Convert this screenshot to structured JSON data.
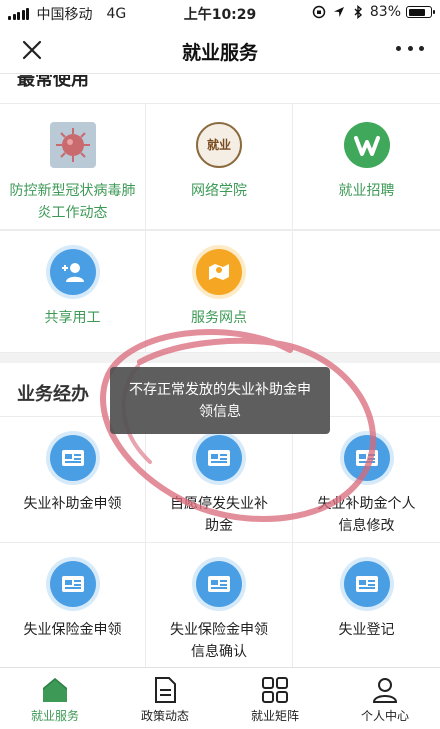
{
  "status_bar": {
    "carrier": "中国移动",
    "network": "4G",
    "time": "上午10:29",
    "battery": "83%",
    "battery_level": 0.83
  },
  "nav": {
    "title": "就业服务",
    "close_icon": "close-icon",
    "more_icon": "more-icon"
  },
  "section_frequent": {
    "title": "最常使用",
    "items": [
      {
        "label": "防控新型冠状病毒肺炎工作动态",
        "icon": "virus-image-icon"
      },
      {
        "label": "网络学院",
        "icon": "seal-logo-icon",
        "seal_text": "就业"
      },
      {
        "label": "就业招聘",
        "icon": "job-logo-icon"
      },
      {
        "label": "共享用工",
        "icon": "add-user-icon"
      },
      {
        "label": "服务网点",
        "icon": "map-pin-icon"
      }
    ]
  },
  "section_business": {
    "title": "业务经办",
    "items": [
      {
        "label": "失业补助金申领",
        "icon": "document-icon"
      },
      {
        "label": "自愿停发失业补助金",
        "icon": "document-icon"
      },
      {
        "label": "失业补助金个人信息修改",
        "icon": "document-icon"
      },
      {
        "label": "失业保险金申领",
        "icon": "document-icon"
      },
      {
        "label": "失业保险金申领信息确认",
        "icon": "document-icon"
      },
      {
        "label": "失业登记",
        "icon": "document-icon"
      }
    ]
  },
  "toast": {
    "message": "不存正常发放的失业补助金申领信息"
  },
  "tabbar": {
    "items": [
      {
        "label": "就业服务",
        "icon": "home-icon",
        "active": true
      },
      {
        "label": "政策动态",
        "icon": "policy-document-icon",
        "active": false
      },
      {
        "label": "就业矩阵",
        "icon": "grid-icon",
        "active": false
      },
      {
        "label": "个人中心",
        "icon": "user-icon",
        "active": false
      }
    ]
  },
  "colors": {
    "accent_green": "#3d9a56",
    "icon_blue": "#4a9fe4",
    "icon_orange": "#f5a623",
    "annotation_red": "#d9687a"
  }
}
